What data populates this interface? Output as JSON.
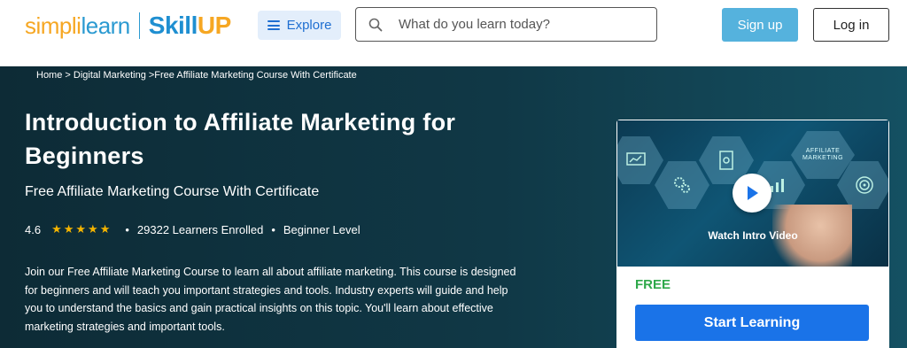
{
  "header": {
    "logo": {
      "part1": "simpli",
      "part2": "learn",
      "part3": "Skill",
      "part4": "UP"
    },
    "explore_label": "Explore",
    "search": {
      "placeholder": "What do you learn today?"
    },
    "signup_label": "Sign up",
    "login_label": "Log in"
  },
  "breadcrumb": {
    "items": [
      "Home",
      "Digital Marketing",
      "Free Affiliate Marketing Course With Certificate"
    ],
    "sep1": " > ",
    "sep2": " >"
  },
  "course": {
    "title": "Introduction to Affiliate Marketing for Beginners",
    "subtitle": "Free Affiliate Marketing Course With Certificate",
    "rating": "4.6",
    "stars_filled": 5,
    "learners": "29322 Learners Enrolled",
    "level": "Beginner Level",
    "description": "Join our Free Affiliate Marketing Course to learn all about affiliate marketing. This course is designed for beginners and will teach you important strategies and tools. Industry experts will guide and help you to understand the basics and gain practical insights on this topic. You'll learn about effective marketing strategies and important tools."
  },
  "card": {
    "video_overlay": "Watch Intro Video",
    "video_hex_text": "AFFILIATE MARKETING",
    "price_label": "FREE",
    "cta_label": "Start Learning"
  },
  "colors": {
    "brand_orange": "#f6a723",
    "brand_blue": "#1f8fd1",
    "cta_blue": "#1a73e8",
    "free_green": "#2ea84a",
    "hero_bg": "#103846"
  },
  "icons": {
    "search": "search-icon",
    "menu": "hamburger-icon",
    "play": "play-icon",
    "star": "star-icon"
  }
}
